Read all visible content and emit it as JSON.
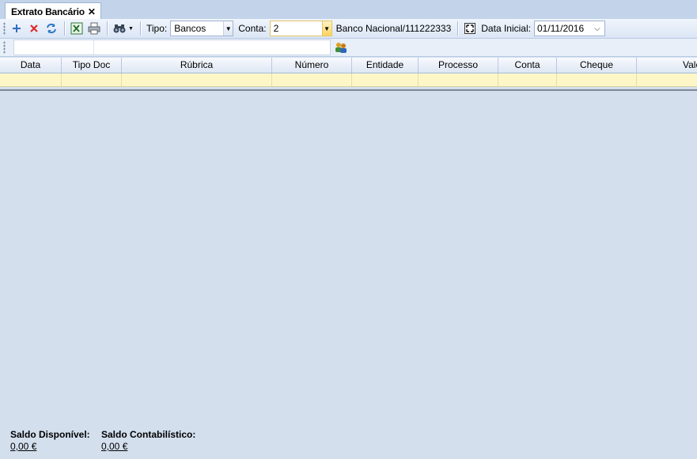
{
  "tab": {
    "title": "Extrato Bancário",
    "close_glyph": "✕"
  },
  "toolbar": {
    "icons": [
      "add-icon",
      "delete-icon",
      "refresh-icon",
      "excel-icon",
      "print-icon",
      "binoculars-icon"
    ],
    "tipo_label": "Tipo:",
    "tipo_value": "Bancos",
    "conta_label": "Conta:",
    "conta_value": "2",
    "bank_info": "Banco Nacional/111222333",
    "data_inicial_label": "Data Inicial:",
    "data_inicial_value": "01/11/2016"
  },
  "grid": {
    "columns": [
      {
        "label": "Data"
      },
      {
        "label": "Tipo Doc"
      },
      {
        "label": "Rúbrica"
      },
      {
        "label": "Número"
      },
      {
        "label": "Entidade"
      },
      {
        "label": "Processo"
      },
      {
        "label": "Conta"
      },
      {
        "label": "Cheque"
      },
      {
        "label": "Valor"
      }
    ]
  },
  "footer": {
    "saldo_disponivel_label": "Saldo Disponível:",
    "saldo_disponivel_value": "0,00 €",
    "saldo_contabilistico_label": "Saldo Contabilístico:",
    "saldo_contabilistico_value": "0,00 €"
  },
  "colors": {
    "accent": "#d4dfee",
    "filter_row": "#fdf7c8"
  }
}
